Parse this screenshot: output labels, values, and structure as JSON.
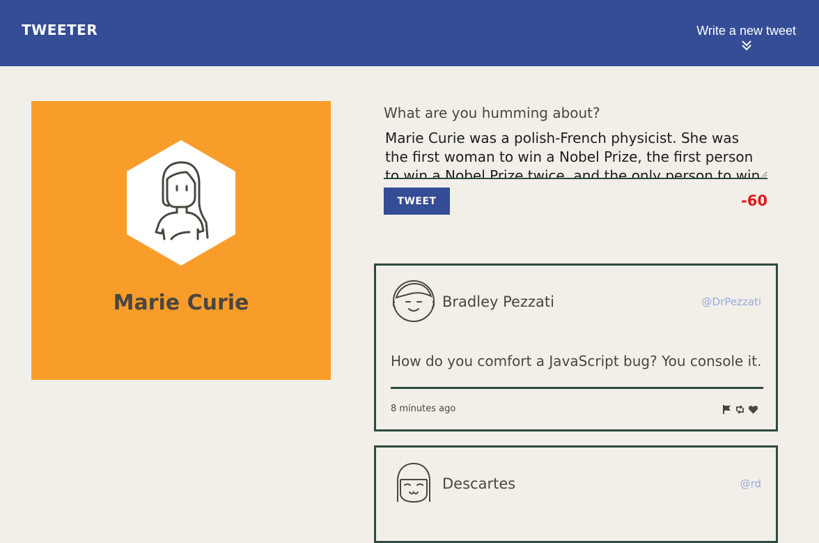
{
  "nav": {
    "logo": "TWEETER",
    "compose_label": "Write a new tweet",
    "compose_icon": "double-chevron-down-icon",
    "background": "#344d96"
  },
  "profile": {
    "name": "Marie Curie",
    "avatar_icon": "woman-avatar-icon",
    "background": "#f99d2a"
  },
  "compose_form": {
    "label": "What are you humming about?",
    "textarea_value": "Marie Curie was a polish-French physicist. She was the first woman to win a Nobel Prize, the first person to win a Nobel Prize twice, and the only person to win a Nobel Prize in two scientific fields.",
    "button_label": "TWEET",
    "counter": "-60",
    "counter_color": "#e11b1b"
  },
  "tweets": [
    {
      "name": "Bradley Pezzati",
      "handle": "@DrPezzati",
      "avatar_icon": "man-avatar-icon",
      "text": "How do you comfort a JavaScript bug? You console it.",
      "time": "8 minutes ago",
      "actions": [
        "flag-icon",
        "retweet-icon",
        "heart-icon"
      ]
    },
    {
      "name": "Descartes",
      "handle": "@rd",
      "avatar_icon": "bob-haircut-avatar-icon"
    }
  ]
}
